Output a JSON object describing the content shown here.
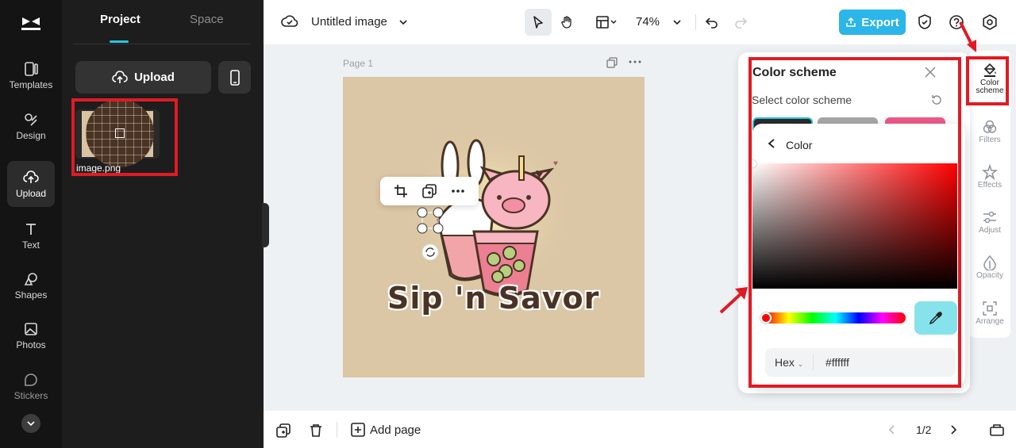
{
  "rail": {
    "items": [
      {
        "label": "Templates",
        "icon": "templates-icon"
      },
      {
        "label": "Design",
        "icon": "design-icon"
      },
      {
        "label": "Upload",
        "icon": "upload-icon",
        "active": true
      },
      {
        "label": "Text",
        "icon": "text-icon"
      },
      {
        "label": "Shapes",
        "icon": "shapes-icon"
      },
      {
        "label": "Photos",
        "icon": "photos-icon"
      },
      {
        "label": "Stickers",
        "icon": "stickers-icon"
      }
    ]
  },
  "panel": {
    "tabs": [
      "Project",
      "Space"
    ],
    "active_tab": "Project",
    "upload_label": "Upload",
    "file_name": "image.png"
  },
  "topbar": {
    "title": "Untitled image",
    "zoom": "74%",
    "export_label": "Export"
  },
  "canvas": {
    "page_label": "Page 1",
    "headline": "Sip 'n Savor"
  },
  "bottombar": {
    "add_page_label": "Add page",
    "page_counter": "1/2"
  },
  "right_tools": [
    {
      "label": "Color scheme",
      "icon": "paint-bucket-icon",
      "active": true
    },
    {
      "label": "Filters",
      "icon": "filters-icon"
    },
    {
      "label": "Effects",
      "icon": "effects-icon"
    },
    {
      "label": "Adjust",
      "icon": "adjust-icon"
    },
    {
      "label": "Opacity",
      "icon": "opacity-icon"
    },
    {
      "label": "Arrange",
      "icon": "arrange-icon"
    }
  ],
  "color_scheme": {
    "title": "Color scheme",
    "subtitle": "Select color scheme",
    "swatch_colors": [
      "#2b2b2b",
      "#a9a9a9",
      "#ee5a8a"
    ]
  },
  "color_popup": {
    "title": "Color",
    "format": "Hex",
    "hex_value": "#ffffff"
  },
  "colors": {
    "accent": "#2cb5e8",
    "annotation": "#e01b24"
  }
}
